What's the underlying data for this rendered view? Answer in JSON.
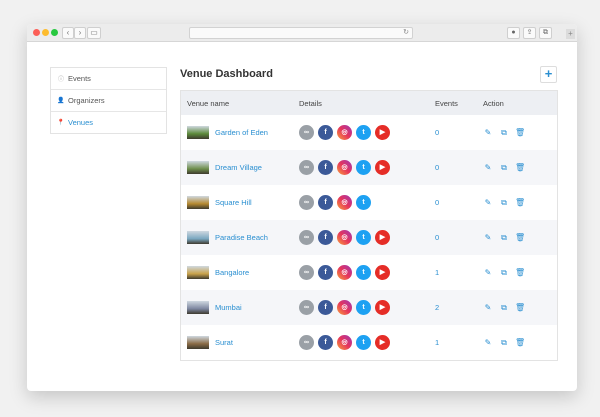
{
  "sidebar": {
    "items": [
      {
        "label": "Events",
        "icon": "info-icon",
        "active": false
      },
      {
        "label": "Organizers",
        "icon": "user-icon",
        "active": false
      },
      {
        "label": "Venues",
        "icon": "location-pin-icon",
        "active": true
      }
    ]
  },
  "main": {
    "title": "Venue Dashboard",
    "add_label": "+",
    "columns": [
      "Venue name",
      "Details",
      "Events",
      "Action"
    ],
    "rows": [
      {
        "name": "Garden of Eden",
        "events": "0",
        "youtube": true,
        "thumb_color": "#5c8a3a"
      },
      {
        "name": "Dream Village",
        "events": "0",
        "youtube": true,
        "thumb_color": "#6f8f4d"
      },
      {
        "name": "Square Hill",
        "events": "0",
        "youtube": false,
        "thumb_color": "#b5892f"
      },
      {
        "name": "Paradise Beach",
        "events": "0",
        "youtube": true,
        "thumb_color": "#7aa7c0"
      },
      {
        "name": "Bangalore",
        "events": "1",
        "youtube": true,
        "thumb_color": "#c9a24a"
      },
      {
        "name": "Mumbai",
        "events": "2",
        "youtube": true,
        "thumb_color": "#7d86a0"
      },
      {
        "name": "Surat",
        "events": "1",
        "youtube": true,
        "thumb_color": "#8a6b45"
      }
    ]
  },
  "colors": {
    "accent": "#2a8fd1",
    "facebook": "#3b5998",
    "twitter": "#1da1f2",
    "youtube": "#e52d27"
  }
}
